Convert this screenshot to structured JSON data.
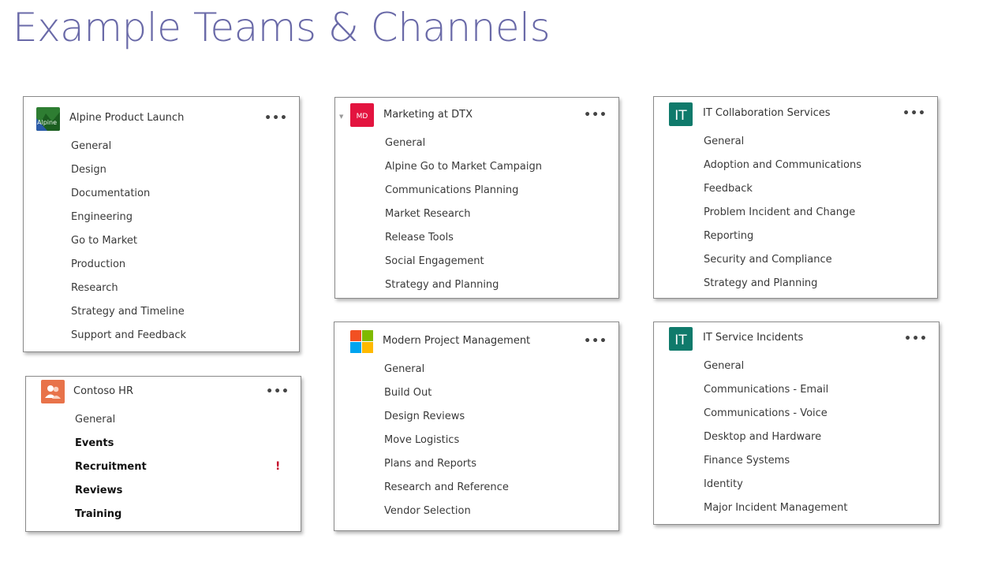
{
  "page": {
    "title": "Example Teams & Channels"
  },
  "teams": [
    {
      "name": "Alpine Product Launch",
      "icon": "alpine-logo-icon",
      "icon_text": "Alpine",
      "icon_color": "#2e7d32",
      "more": "•••",
      "channels": [
        {
          "label": "General"
        },
        {
          "label": "Design"
        },
        {
          "label": "Documentation"
        },
        {
          "label": "Engineering"
        },
        {
          "label": "Go to Market"
        },
        {
          "label": "Production"
        },
        {
          "label": "Research"
        },
        {
          "label": "Strategy and Timeline"
        },
        {
          "label": "Support and Feedback"
        }
      ]
    },
    {
      "name": "Contoso HR",
      "icon": "people-icon",
      "icon_color": "#e8734a",
      "more": "•••",
      "alert": "!",
      "channels": [
        {
          "label": "General"
        },
        {
          "label": "Events"
        },
        {
          "label": "Recruitment"
        },
        {
          "label": "Reviews"
        },
        {
          "label": "Training"
        }
      ]
    },
    {
      "name": "Marketing at DTX",
      "icon": "md-initials-icon",
      "icon_text": "MD",
      "icon_color": "#e3143f",
      "more": "•••",
      "channels": [
        {
          "label": "General"
        },
        {
          "label": "Alpine Go to Market Campaign"
        },
        {
          "label": "Communications Planning"
        },
        {
          "label": "Market Research"
        },
        {
          "label": "Release Tools"
        },
        {
          "label": "Social Engagement"
        },
        {
          "label": "Strategy and Planning"
        }
      ]
    },
    {
      "name": "Modern Project Management",
      "icon": "microsoft-logo-icon",
      "more": "•••",
      "channels": [
        {
          "label": "General"
        },
        {
          "label": "Build Out"
        },
        {
          "label": "Design Reviews"
        },
        {
          "label": "Move Logistics"
        },
        {
          "label": "Plans and Reports"
        },
        {
          "label": "Research and Reference"
        },
        {
          "label": "Vendor Selection"
        }
      ]
    },
    {
      "name": "IT Collaboration Services",
      "icon": "it-initials-icon",
      "icon_text": "IT",
      "icon_color": "#0f7a6b",
      "more": "•••",
      "channels": [
        {
          "label": "General"
        },
        {
          "label": "Adoption and Communications"
        },
        {
          "label": "Feedback"
        },
        {
          "label": "Problem Incident and Change"
        },
        {
          "label": "Reporting"
        },
        {
          "label": "Security and Compliance"
        },
        {
          "label": "Strategy and Planning"
        }
      ]
    },
    {
      "name": "IT Service Incidents",
      "icon": "it-initials-icon",
      "icon_text": "IT",
      "icon_color": "#0f7a6b",
      "more": "•••",
      "channels": [
        {
          "label": "General"
        },
        {
          "label": "Communications - Email"
        },
        {
          "label": "Communications - Voice"
        },
        {
          "label": "Desktop and Hardware"
        },
        {
          "label": "Finance Systems"
        },
        {
          "label": "Identity"
        },
        {
          "label": "Major Incident Management"
        }
      ]
    }
  ]
}
